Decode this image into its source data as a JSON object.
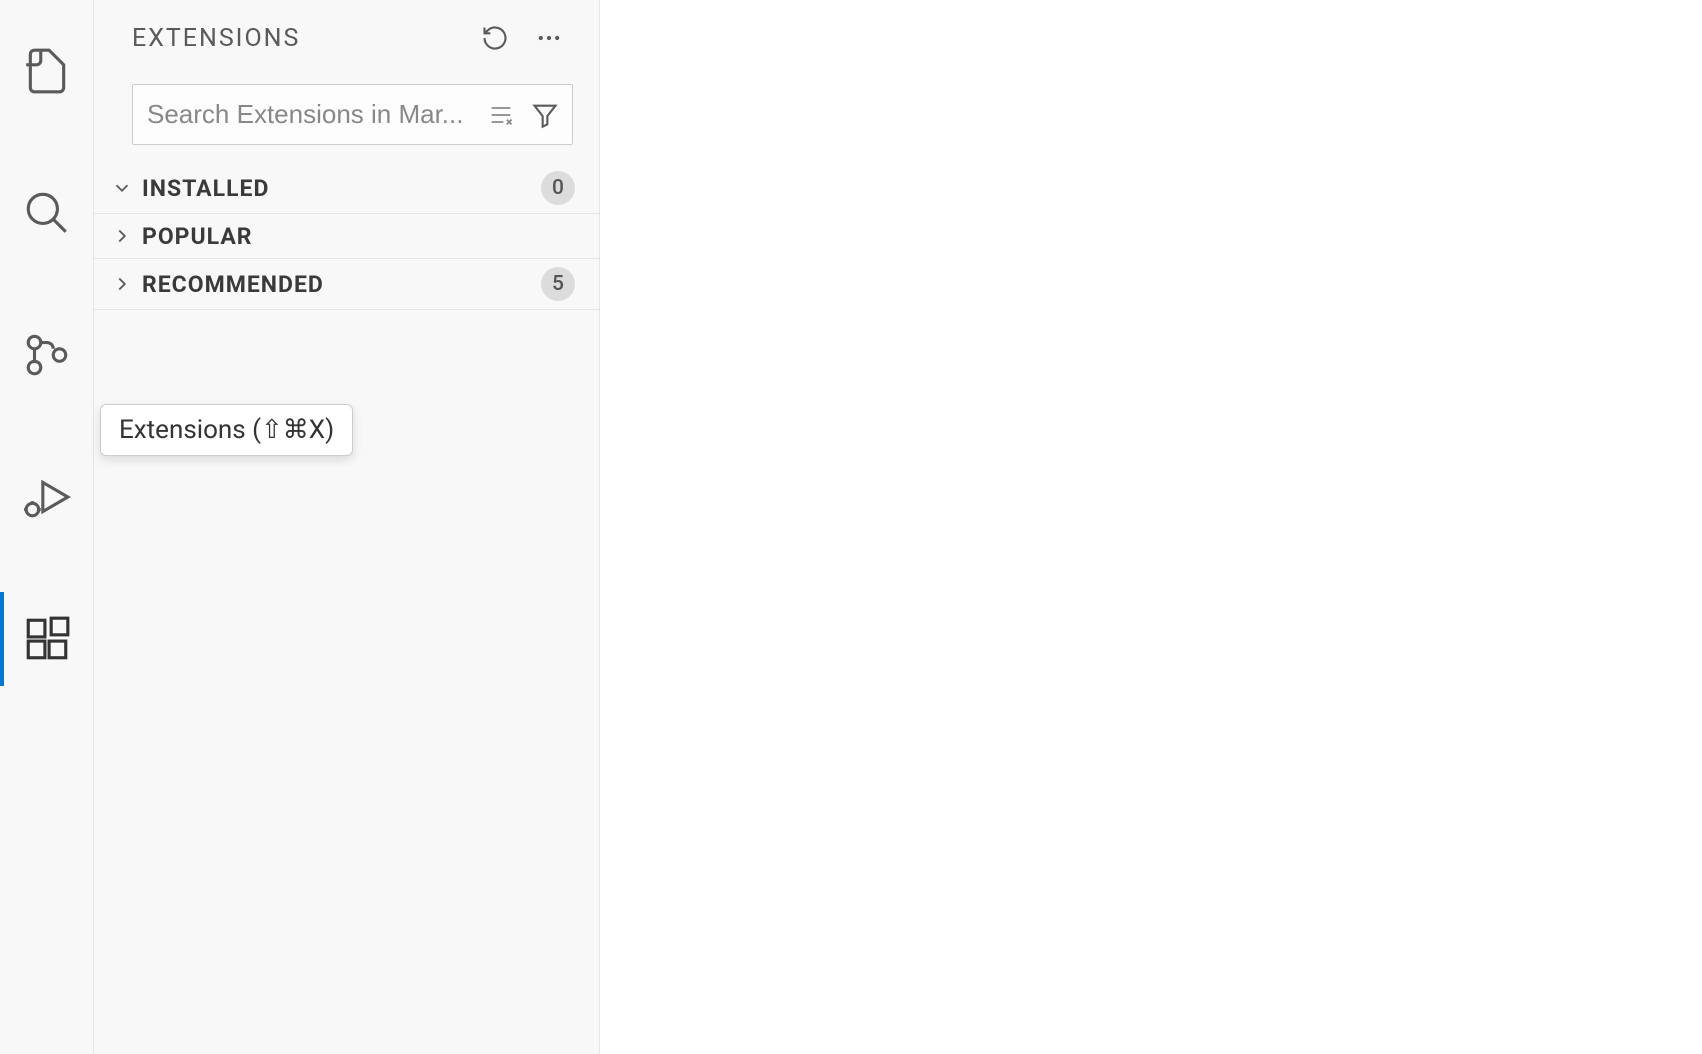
{
  "activity_bar": {
    "items": [
      {
        "name": "explorer",
        "active": false
      },
      {
        "name": "search",
        "active": false
      },
      {
        "name": "source-control",
        "active": false
      },
      {
        "name": "run-debug",
        "active": false
      },
      {
        "name": "extensions",
        "active": true
      }
    ]
  },
  "sidebar": {
    "title": "EXTENSIONS",
    "search_placeholder": "Search Extensions in Mar...",
    "search_value": "",
    "sections": [
      {
        "label": "INSTALLED",
        "expanded": true,
        "badge": "0"
      },
      {
        "label": "POPULAR",
        "expanded": false,
        "badge": null
      },
      {
        "label": "RECOMMENDED",
        "expanded": false,
        "badge": "5"
      }
    ]
  },
  "tooltip": {
    "text": "Extensions (⇧⌘X)"
  }
}
